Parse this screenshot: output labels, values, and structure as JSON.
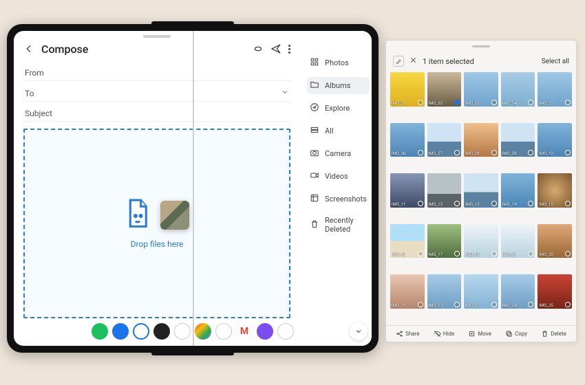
{
  "compose": {
    "title": "Compose",
    "from_label": "From",
    "to_label": "To",
    "subject_label": "Subject",
    "drop_text": "Drop files here"
  },
  "rail": {
    "items": [
      {
        "icon": "grid",
        "label": "Photos"
      },
      {
        "icon": "folder",
        "label": "Albums"
      },
      {
        "icon": "compass",
        "label": "Explore"
      },
      {
        "icon": "drive",
        "label": "All"
      },
      {
        "icon": "camera",
        "label": "Camera"
      },
      {
        "icon": "video",
        "label": "Videos"
      },
      {
        "icon": "screenshot",
        "label": "Screenshots"
      },
      {
        "icon": "trash",
        "label": "Recently Deleted"
      }
    ],
    "active_index": 1
  },
  "taskbar": {
    "apps": [
      "app-drawer",
      "assistant",
      "browser",
      "phone",
      "contacts",
      "chrome",
      "camera",
      "gmail",
      "notes",
      "files"
    ]
  },
  "gallery": {
    "selection_text": "1 item selected",
    "select_all": "Select all",
    "footer": [
      {
        "icon": "share",
        "label": "Share"
      },
      {
        "icon": "eye-off",
        "label": "Hide"
      },
      {
        "icon": "move",
        "label": "Move"
      },
      {
        "icon": "copy",
        "label": "Copy"
      },
      {
        "icon": "trash",
        "label": "Delete"
      }
    ],
    "items": [
      {
        "cls": "c-yellow",
        "name": "IMG_01"
      },
      {
        "cls": "c-suit",
        "name": "IMG_02",
        "selected": true
      },
      {
        "cls": "c-plane1",
        "name": "IMG_03"
      },
      {
        "cls": "c-plane2",
        "name": "IMG_04"
      },
      {
        "cls": "c-plane1",
        "name": "IMG_05"
      },
      {
        "cls": "c-sky1",
        "name": "IMG_06"
      },
      {
        "cls": "c-horizon",
        "name": "IMG_07"
      },
      {
        "cls": "c-sunset",
        "name": "IMG_08"
      },
      {
        "cls": "c-horizon",
        "name": "IMG_09"
      },
      {
        "cls": "c-sky1",
        "name": "IMG_10"
      },
      {
        "cls": "c-dusk",
        "name": "IMG_11"
      },
      {
        "cls": "c-boat",
        "name": "IMG_12"
      },
      {
        "cls": "c-horizon",
        "name": "IMG_13"
      },
      {
        "cls": "c-sky1",
        "name": "IMG_14"
      },
      {
        "cls": "c-owl",
        "name": "IMG_15"
      },
      {
        "cls": "c-beach",
        "name": "IMG_16"
      },
      {
        "cls": "c-green",
        "name": "IMG_17"
      },
      {
        "cls": "c-ice",
        "name": "IMG_18"
      },
      {
        "cls": "c-ice",
        "name": "IMG_19"
      },
      {
        "cls": "c-warm",
        "name": "IMG_20"
      },
      {
        "cls": "c-selfie",
        "name": "IMG_21"
      },
      {
        "cls": "c-sky2",
        "name": "IMG_22"
      },
      {
        "cls": "c-sky3",
        "name": "IMG_23"
      },
      {
        "cls": "c-sky2",
        "name": "IMG_24"
      },
      {
        "cls": "c-red",
        "name": "IMG_25"
      }
    ]
  }
}
